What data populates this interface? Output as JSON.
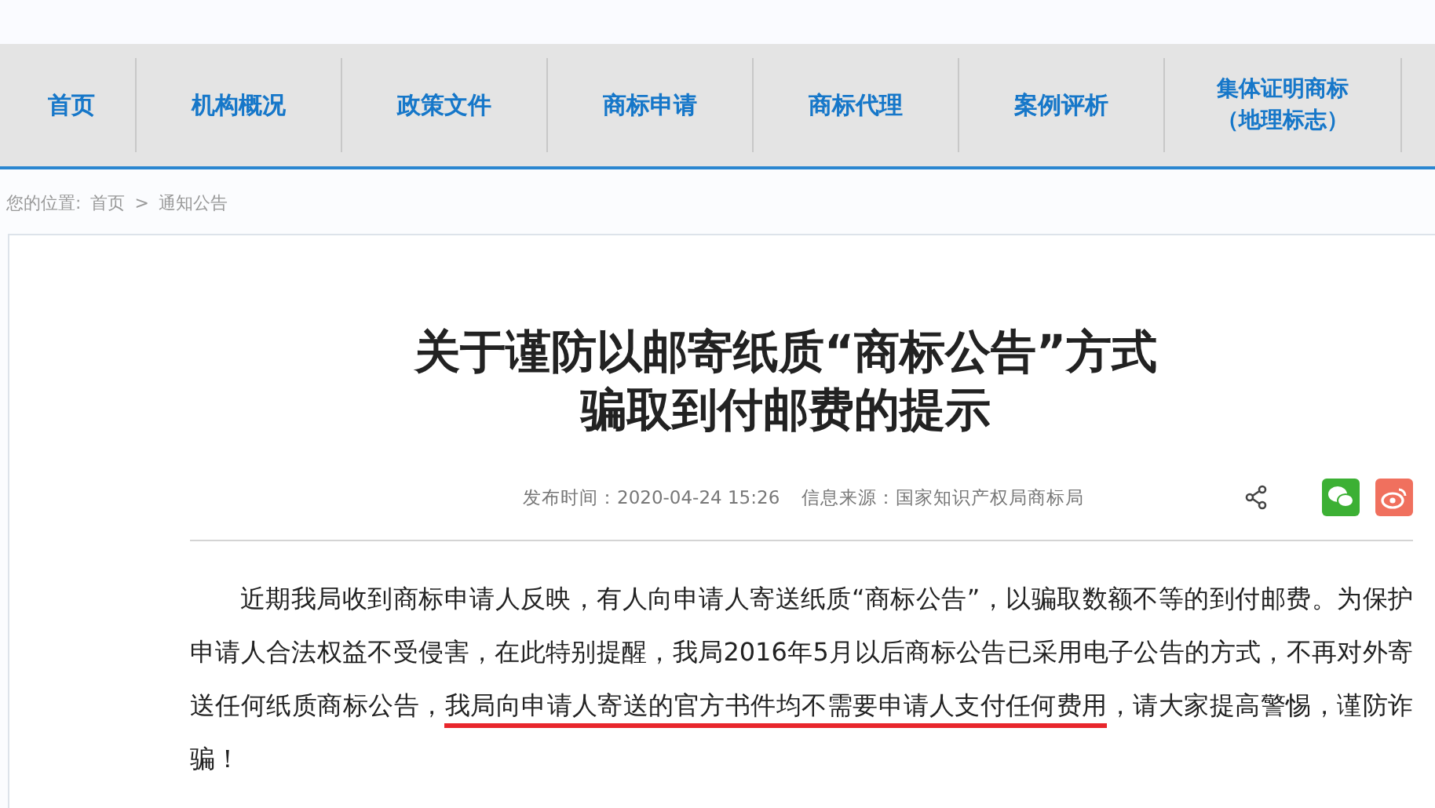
{
  "nav": {
    "items": [
      {
        "label": "首页"
      },
      {
        "label": "机构概况"
      },
      {
        "label": "政策文件"
      },
      {
        "label": "商标申请"
      },
      {
        "label": "商标代理"
      },
      {
        "label": "案例评析"
      },
      {
        "lines": [
          "集体证明商标",
          "（地理标志）"
        ]
      }
    ]
  },
  "breadcrumb": {
    "prefix": "您的位置:",
    "items": [
      "首页",
      "通知公告"
    ],
    "separator": ">"
  },
  "article": {
    "title": [
      "关于谨防以邮寄纸质“商标公告”方式",
      "骗取到付邮费的提示"
    ],
    "published": "发布时间：2020-04-24 15:26",
    "source": "信息来源：国家知识产权局商标局",
    "paragraph": [
      {
        "text": "近期我局收到商标申请人反映，有人向申请人寄送纸质“商标公告”，以骗取数额不等的到付邮费。为保护申请人合法权益不受侵害，在此特别提醒，我局2016年5月以后商标公告已采用电子公告的方式，不再对外寄送任何纸质商标公告，",
        "underlined": false
      },
      {
        "text": "我局向申请人寄送的官方书件均不需要申请人支付任何费用",
        "underlined": true
      },
      {
        "text": "，请大家提高警惕，谨防诈骗！",
        "underlined": false
      }
    ]
  }
}
